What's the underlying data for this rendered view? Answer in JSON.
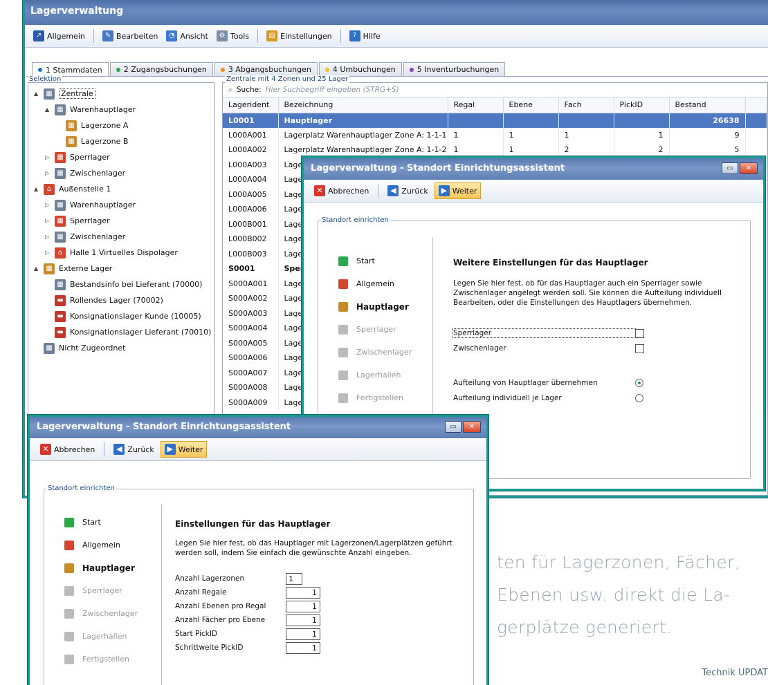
{
  "main": {
    "title": "Lagerverwaltung",
    "menu": [
      {
        "label": "Allgemein",
        "icon": "arrow-icon"
      },
      {
        "label": "Bearbeiten",
        "icon": "edit-icon"
      },
      {
        "label": "Ansicht",
        "icon": "view-icon"
      },
      {
        "label": "Tools",
        "icon": "tools-icon"
      },
      {
        "label": "Einstellungen",
        "icon": "settings-icon"
      },
      {
        "label": "Hilfe",
        "icon": "help-icon"
      }
    ],
    "tabs": [
      {
        "label": "1 Stammdaten",
        "color": "#1f6fd1"
      },
      {
        "label": "2 Zugangsbuchungen",
        "color": "#2aa84a"
      },
      {
        "label": "3 Abgangsbuchungen",
        "color": "#f08a1c"
      },
      {
        "label": "4 Umbuchungen",
        "color": "#f2c21d"
      },
      {
        "label": "5 Inventurbuchungen",
        "color": "#8a3fb8"
      }
    ],
    "selection_label": "Selektion",
    "tree": [
      {
        "label": "Zentrale",
        "level": 0,
        "caret": "▲",
        "icon": "warehouse-icon"
      },
      {
        "label": "Warenhauptlager",
        "level": 1,
        "caret": "▲",
        "icon": "warehouse-icon"
      },
      {
        "label": "Lagerzone A",
        "level": 2,
        "caret": "",
        "icon": "zone-icon"
      },
      {
        "label": "Lagerzone B",
        "level": 2,
        "caret": "",
        "icon": "zone-icon"
      },
      {
        "label": "Sperrlager",
        "level": 1,
        "caret": "▷",
        "icon": "blocked-icon"
      },
      {
        "label": "Zwischenlager",
        "level": 1,
        "caret": "▷",
        "icon": "warehouse-icon"
      },
      {
        "label": "Außenstelle 1",
        "level": 0,
        "caret": "▲",
        "icon": "house-icon"
      },
      {
        "label": "Warenhauptlager",
        "level": 1,
        "caret": "▷",
        "icon": "warehouse-icon"
      },
      {
        "label": "Sperrlager",
        "level": 1,
        "caret": "▷",
        "icon": "blocked-icon"
      },
      {
        "label": "Zwischenlager",
        "level": 1,
        "caret": "▷",
        "icon": "warehouse-icon"
      },
      {
        "label": "Halle 1 Virtuelles Dispolager",
        "level": 1,
        "caret": "▷",
        "icon": "house-icon"
      },
      {
        "label": "Externe Lager",
        "level": 0,
        "caret": "▲",
        "icon": "zone-icon"
      },
      {
        "label": "Bestandsinfo bei Lieferant (70000)",
        "level": 1,
        "caret": "",
        "icon": "warehouse-icon"
      },
      {
        "label": "Rollendes Lager (70002)",
        "level": 1,
        "caret": "",
        "icon": "truck-icon"
      },
      {
        "label": "Konsignationslager Kunde (10005)",
        "level": 1,
        "caret": "",
        "icon": "truck-icon"
      },
      {
        "label": "Konsignationslager Lieferant (70010)",
        "level": 1,
        "caret": "",
        "icon": "truck-icon"
      },
      {
        "label": "Nicht Zugeordnet",
        "level": 0,
        "caret": "",
        "icon": "warehouse-icon"
      }
    ],
    "grid_label": "Zentrale mit 4 Zonen und 25 Lager",
    "search": {
      "label": "Suche:",
      "placeholder": "Hier Suchbegriff eingeben (STRG+S)"
    },
    "columns": [
      "Lagerident",
      "Bezeichnung",
      "Regal",
      "Ebene",
      "Fach",
      "PickID",
      "Bestand"
    ],
    "rows": [
      {
        "id": "L0001",
        "name": "Hauptlager",
        "regal": "",
        "ebene": "",
        "fach": "",
        "pick": "",
        "bestand": "26638",
        "bold": true,
        "selected": true
      },
      {
        "id": "L000A001",
        "name": "Lagerplatz Warenhauptlager Zone A: 1-1-1",
        "regal": "1",
        "ebene": "1",
        "fach": "1",
        "pick": "1",
        "bestand": "9"
      },
      {
        "id": "L000A002",
        "name": "Lagerplatz Warenhauptlager Zone A: 1-1-2",
        "regal": "1",
        "ebene": "1",
        "fach": "2",
        "pick": "2",
        "bestand": "5"
      },
      {
        "id": "L000A003",
        "name": "Lage",
        "regal": "",
        "ebene": "",
        "fach": "",
        "pick": "",
        "bestand": ""
      },
      {
        "id": "L000A004",
        "name": "Lage",
        "regal": "",
        "ebene": "",
        "fach": "",
        "pick": "",
        "bestand": ""
      },
      {
        "id": "L000A005",
        "name": "Lage",
        "regal": "",
        "ebene": "",
        "fach": "",
        "pick": "",
        "bestand": ""
      },
      {
        "id": "L000A006",
        "name": "Lage",
        "regal": "",
        "ebene": "",
        "fach": "",
        "pick": "",
        "bestand": ""
      },
      {
        "id": "L000B001",
        "name": "Lage",
        "regal": "",
        "ebene": "",
        "fach": "",
        "pick": "",
        "bestand": ""
      },
      {
        "id": "L000B002",
        "name": "Lage",
        "regal": "",
        "ebene": "",
        "fach": "",
        "pick": "",
        "bestand": ""
      },
      {
        "id": "L000B003",
        "name": "Lage",
        "regal": "",
        "ebene": "",
        "fach": "",
        "pick": "",
        "bestand": ""
      },
      {
        "id": "S0001",
        "name": "Sper",
        "regal": "",
        "ebene": "",
        "fach": "",
        "pick": "",
        "bestand": "",
        "bold": true
      },
      {
        "id": "S000A001",
        "name": "Lage",
        "regal": "",
        "ebene": "",
        "fach": "",
        "pick": "",
        "bestand": ""
      },
      {
        "id": "S000A002",
        "name": "Lage",
        "regal": "",
        "ebene": "",
        "fach": "",
        "pick": "",
        "bestand": ""
      },
      {
        "id": "S000A003",
        "name": "Lage",
        "regal": "",
        "ebene": "",
        "fach": "",
        "pick": "",
        "bestand": ""
      },
      {
        "id": "S000A004",
        "name": "Lage",
        "regal": "",
        "ebene": "",
        "fach": "",
        "pick": "",
        "bestand": ""
      },
      {
        "id": "S000A005",
        "name": "Lage",
        "regal": "",
        "ebene": "",
        "fach": "",
        "pick": "",
        "bestand": ""
      },
      {
        "id": "S000A006",
        "name": "Lage",
        "regal": "",
        "ebene": "",
        "fach": "",
        "pick": "",
        "bestand": ""
      },
      {
        "id": "S000A007",
        "name": "Lage",
        "regal": "",
        "ebene": "",
        "fach": "",
        "pick": "",
        "bestand": ""
      },
      {
        "id": "S000A008",
        "name": "Lage",
        "regal": "",
        "ebene": "",
        "fach": "",
        "pick": "",
        "bestand": ""
      },
      {
        "id": "S000A009",
        "name": "Lage",
        "regal": "",
        "ebene": "",
        "fach": "",
        "pick": "",
        "bestand": ""
      }
    ]
  },
  "wizard_common": {
    "title": "Lagerverwaltung - Standort Einrichtungsassistent",
    "cancel": "Abbrechen",
    "back": "Zurück",
    "next": "Weiter",
    "group_label": "Standort einrichten",
    "steps": [
      "Start",
      "Allgemein",
      "Hauptlager",
      "Sperrlager",
      "Zwischenlager",
      "Lagerhallen",
      "Fertigstellen"
    ]
  },
  "wizard1": {
    "heading": "Weitere Einstellungen für das Hauptlager",
    "text": "Legen Sie hier fest, ob für das Hauptlager auch ein Sperrlager sowie Zwischenlager angelegt werden soll. Sie können die Aufteilung individuell Bearbeiten, oder die Einstellungen des Hauptlagers übernehmen.",
    "checks": [
      {
        "label": "Sperrlager",
        "checked": false
      },
      {
        "label": "Zwischenlager",
        "checked": false
      }
    ],
    "radios": [
      {
        "label": "Aufteilung von Hauptlager übernehmen",
        "selected": true
      },
      {
        "label": "Aufteilung individuell je Lager",
        "selected": false
      }
    ]
  },
  "wizard2": {
    "heading": "Einstellungen für das Hauptlager",
    "text": "Legen Sie hier fest, ob das Hauptlager mit Lagerzonen/Lagerplätzen geführt werden soll, indem Sie einfach die gewünschte Anzahl eingeben.",
    "fields": [
      {
        "label": "Anzahl Lagerzonen",
        "value": "1"
      },
      {
        "label": "Anzahl Regale",
        "value": "1"
      },
      {
        "label": "Anzahl Ebenen pro Regal",
        "value": "1"
      },
      {
        "label": "Anzahl Fächer pro Ebene",
        "value": "1"
      },
      {
        "label": "Start PickID",
        "value": "1"
      },
      {
        "label": "Schrittweite PickID",
        "value": "1"
      }
    ]
  },
  "article": {
    "lines": [
      "ten für Lagerzonen, Fächer,",
      "Ebenen usw. direkt die La-",
      "gerplätze generiert."
    ],
    "footer": "Technik UPDAT"
  },
  "colors": {
    "accent": "#1b9a94",
    "selection": "#4f78c2",
    "title_bar": "#5a7ab0"
  }
}
